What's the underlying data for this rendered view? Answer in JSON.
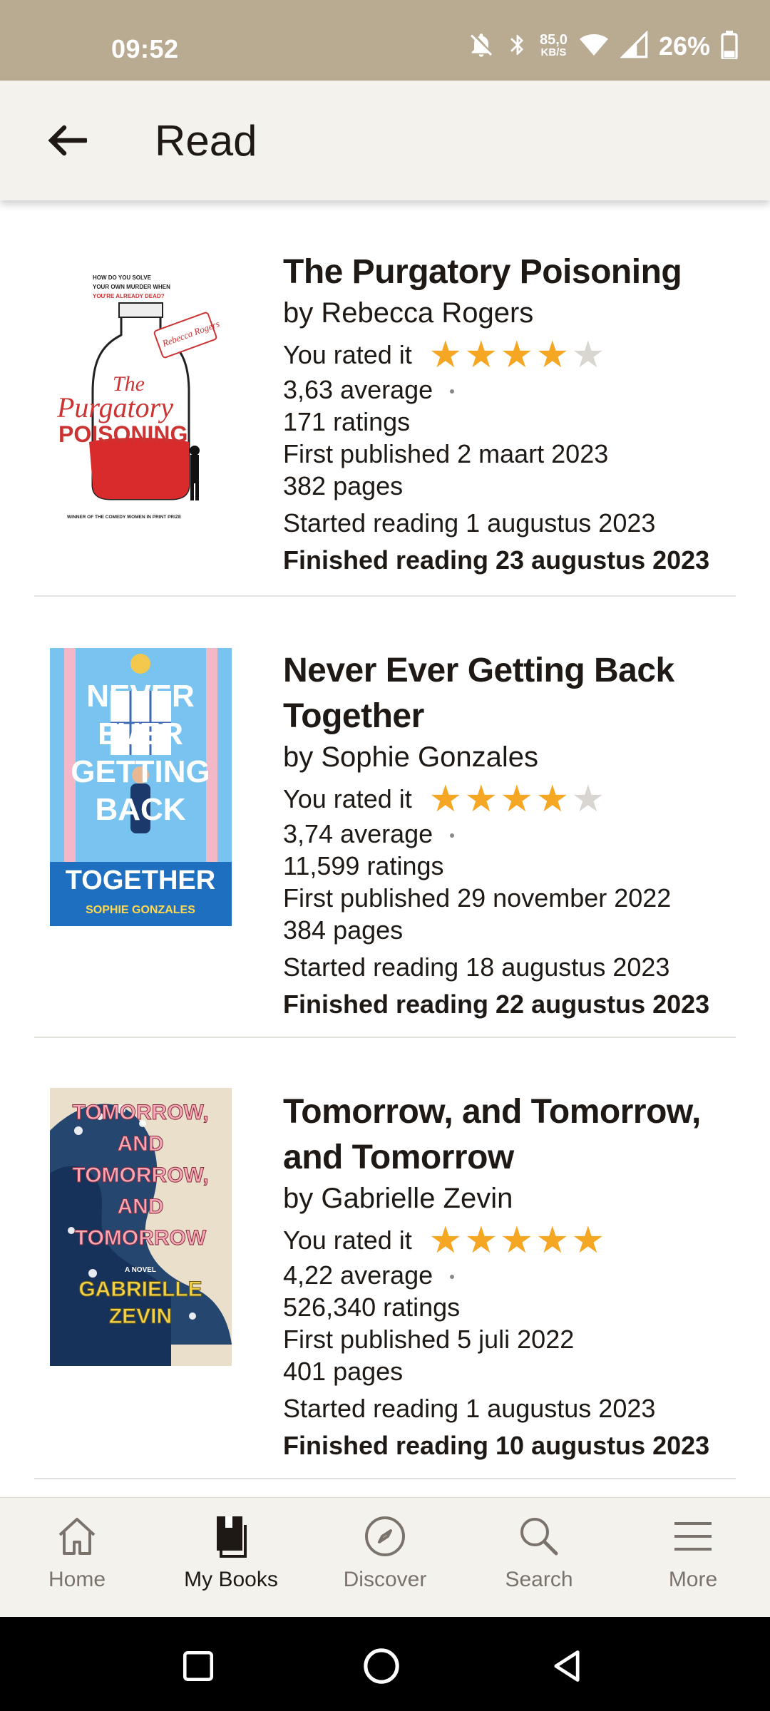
{
  "status_bar": {
    "time": "09:52",
    "speed_value": "85,0",
    "speed_unit": "KB/S",
    "battery": "26%",
    "icons": [
      "bell-off-icon",
      "bluetooth-icon",
      "wifi-icon",
      "signal-icon",
      "battery-icon"
    ]
  },
  "header": {
    "back_icon": "arrow-left-icon",
    "title": "Read"
  },
  "colors": {
    "status_bar": "#b9aa92",
    "app_bar": "#f4f2ec",
    "star_on": "#f5a623",
    "star_off": "#d9d6d2"
  },
  "books": [
    {
      "cover_text": {
        "tagline_1": "HOW DO YOU SOLVE",
        "tagline_2": "YOUR OWN MURDER WHEN",
        "tagline_3": "YOU'RE ALREADY DEAD?",
        "tag": "Rebecca Rogers",
        "word_1": "The",
        "word_2": "Purgatory",
        "word_3": "POISONING",
        "footer": "WINNER OF THE COMEDY WOMEN IN PRINT PRIZE"
      },
      "title": "The Purgatory Poisoning",
      "author": "by Rebecca Rogers",
      "rated_label": "You rated it",
      "rating": 4,
      "average": "3,63 average",
      "ratings_count": "171 ratings",
      "first_published": "First published 2 maart 2023",
      "pages": "382 pages",
      "started": "Started reading 1 augustus 2023",
      "finished": "Finished reading 23 augustus 2023"
    },
    {
      "cover_text": {
        "line_1": "NEVER",
        "line_2": "EVER",
        "line_3": "GETTING",
        "line_4": "BACK",
        "line_5": "TOGETHER",
        "author": "SOPHIE GONZALES"
      },
      "title": "Never Ever Getting Back Together",
      "author": "by Sophie Gonzales",
      "rated_label": "You rated it",
      "rating": 4,
      "average": "3,74 average",
      "ratings_count": "11,599 ratings",
      "first_published": "First published 29 november 2022",
      "pages": "384 pages",
      "started": "Started reading 18 augustus 2023",
      "finished": "Finished reading 22 augustus 2023"
    },
    {
      "cover_text": {
        "line_1": "TOMORROW,",
        "line_2": "AND",
        "line_3": "TOMORROW,",
        "line_4": "AND",
        "line_5": "TOMORROW",
        "novel": "A NOVEL",
        "author_1": "GABRIELLE",
        "author_2": "ZEVIN"
      },
      "title": "Tomorrow, and Tomorrow, and Tomorrow",
      "author": "by Gabrielle Zevin",
      "rated_label": "You rated it",
      "rating": 5,
      "average": "4,22 average",
      "ratings_count": "526,340 ratings",
      "first_published": "First published 5 juli 2022",
      "pages": "401 pages",
      "started": "Started reading 1 augustus 2023",
      "finished": "Finished reading 10 augustus 2023"
    }
  ],
  "bottom_nav": [
    {
      "label": "Home",
      "icon": "home-icon",
      "active": false
    },
    {
      "label": "My Books",
      "icon": "book-icon",
      "active": true
    },
    {
      "label": "Discover",
      "icon": "compass-icon",
      "active": false
    },
    {
      "label": "Search",
      "icon": "search-icon",
      "active": false
    },
    {
      "label": "More",
      "icon": "menu-icon",
      "active": false
    }
  ]
}
